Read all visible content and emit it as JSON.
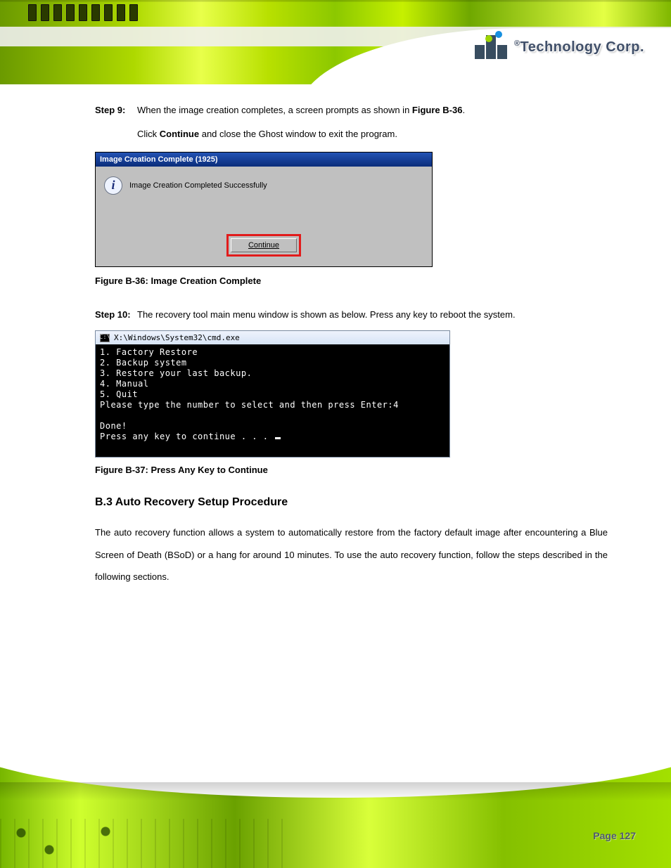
{
  "header": {
    "brand_r": "®",
    "brand_text": "Technology Corp."
  },
  "steps": {
    "s9": {
      "num": "Step 9:",
      "text_a": "When the image creation completes, a screen prompts as shown in ",
      "ref": "Figure B-36",
      "dot": ".",
      "text_b_a": "Click ",
      "text_b_bold": "Continue",
      "text_b_c": " and close the Ghost window to exit the program."
    },
    "s10": {
      "num": "Step 10:",
      "text": "The recovery tool main menu window is shown as below. Press any key to reboot the system."
    }
  },
  "ghost": {
    "title": "Image Creation Complete (1925)",
    "msg": "Image Creation Completed Successfully",
    "btn": "Continue"
  },
  "fig36": "Figure B-36: Image Creation Complete",
  "cmd": {
    "title": "X:\\Windows\\System32\\cmd.exe",
    "lines": "1. Factory Restore\n2. Backup system\n3. Restore your last backup.\n4. Manual\n5. Quit\nPlease type the number to select and then press Enter:4\n\nDone!\nPress any key to continue . . . "
  },
  "fig37": "Figure B-37: Press Any Key to Continue",
  "section": {
    "title": "B.3 Auto Recovery Setup Procedure",
    "body": "The auto recovery function allows a system to automatically restore from the factory default image after encountering a Blue Screen of Death (BSoD) or a hang for around 10 minutes. To use the auto recovery function, follow the steps described in the following sections."
  },
  "footer": {
    "page": "Page 127"
  }
}
